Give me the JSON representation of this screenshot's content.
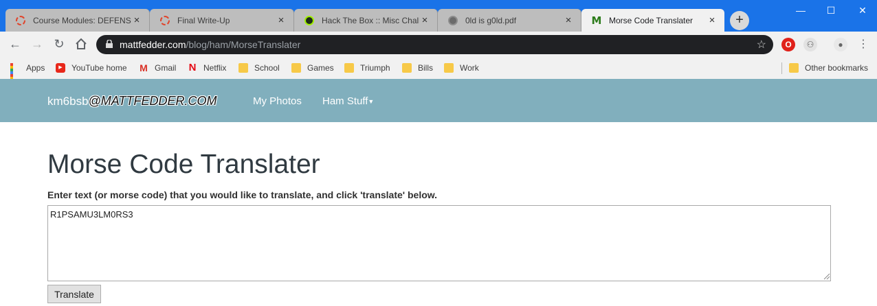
{
  "browser": {
    "tabs": [
      {
        "title": "Course Modules: DEFENSE /",
        "favicon": "dashed-ring-icon",
        "close": "×"
      },
      {
        "title": "Final Write-Up",
        "favicon": "dashed-ring-icon",
        "close": "×"
      },
      {
        "title": "Hack The Box :: Misc Challe",
        "favicon": "hackthebox-icon",
        "close": "×"
      },
      {
        "title": "0ld is g0ld.pdf",
        "favicon": "globe-icon",
        "close": "×"
      },
      {
        "title": "Morse Code Translater",
        "favicon": "M",
        "close": "×",
        "active": true
      }
    ],
    "new_tab": "+",
    "window_controls": {
      "minimize": "—",
      "maximize": "☐",
      "close": "✕"
    },
    "address": {
      "host": "mattfedder.com",
      "path": "/blog/ham/MorseTranslater"
    },
    "bookmarks": [
      {
        "label": "Apps",
        "icon": "apps-grid-icon"
      },
      {
        "label": "YouTube home",
        "icon": "youtube-icon"
      },
      {
        "label": "Gmail",
        "icon": "gmail-icon"
      },
      {
        "label": "Netflix",
        "icon": "netflix-icon"
      },
      {
        "label": "School",
        "icon": "folder-icon"
      },
      {
        "label": "Games",
        "icon": "folder-icon"
      },
      {
        "label": "Triumph",
        "icon": "folder-icon"
      },
      {
        "label": "Bills",
        "icon": "folder-icon"
      },
      {
        "label": "Work",
        "icon": "folder-icon"
      }
    ],
    "other_bookmarks": "Other bookmarks",
    "colors": {
      "accent": "#1a73e8",
      "site_nav": "#81afbd"
    }
  },
  "site": {
    "brand_prefix": "km6bsb",
    "brand_email": "@MATTFEDDER.COM",
    "nav": {
      "photos": "My Photos",
      "ham": "Ham Stuff"
    }
  },
  "page": {
    "title": "Morse Code Translater",
    "instructions": "Enter text (or morse code) that you would like to translate, and click 'translate' below.",
    "input_value": "R1PSAMU3LM0RS3",
    "translate_label": "Translate"
  }
}
